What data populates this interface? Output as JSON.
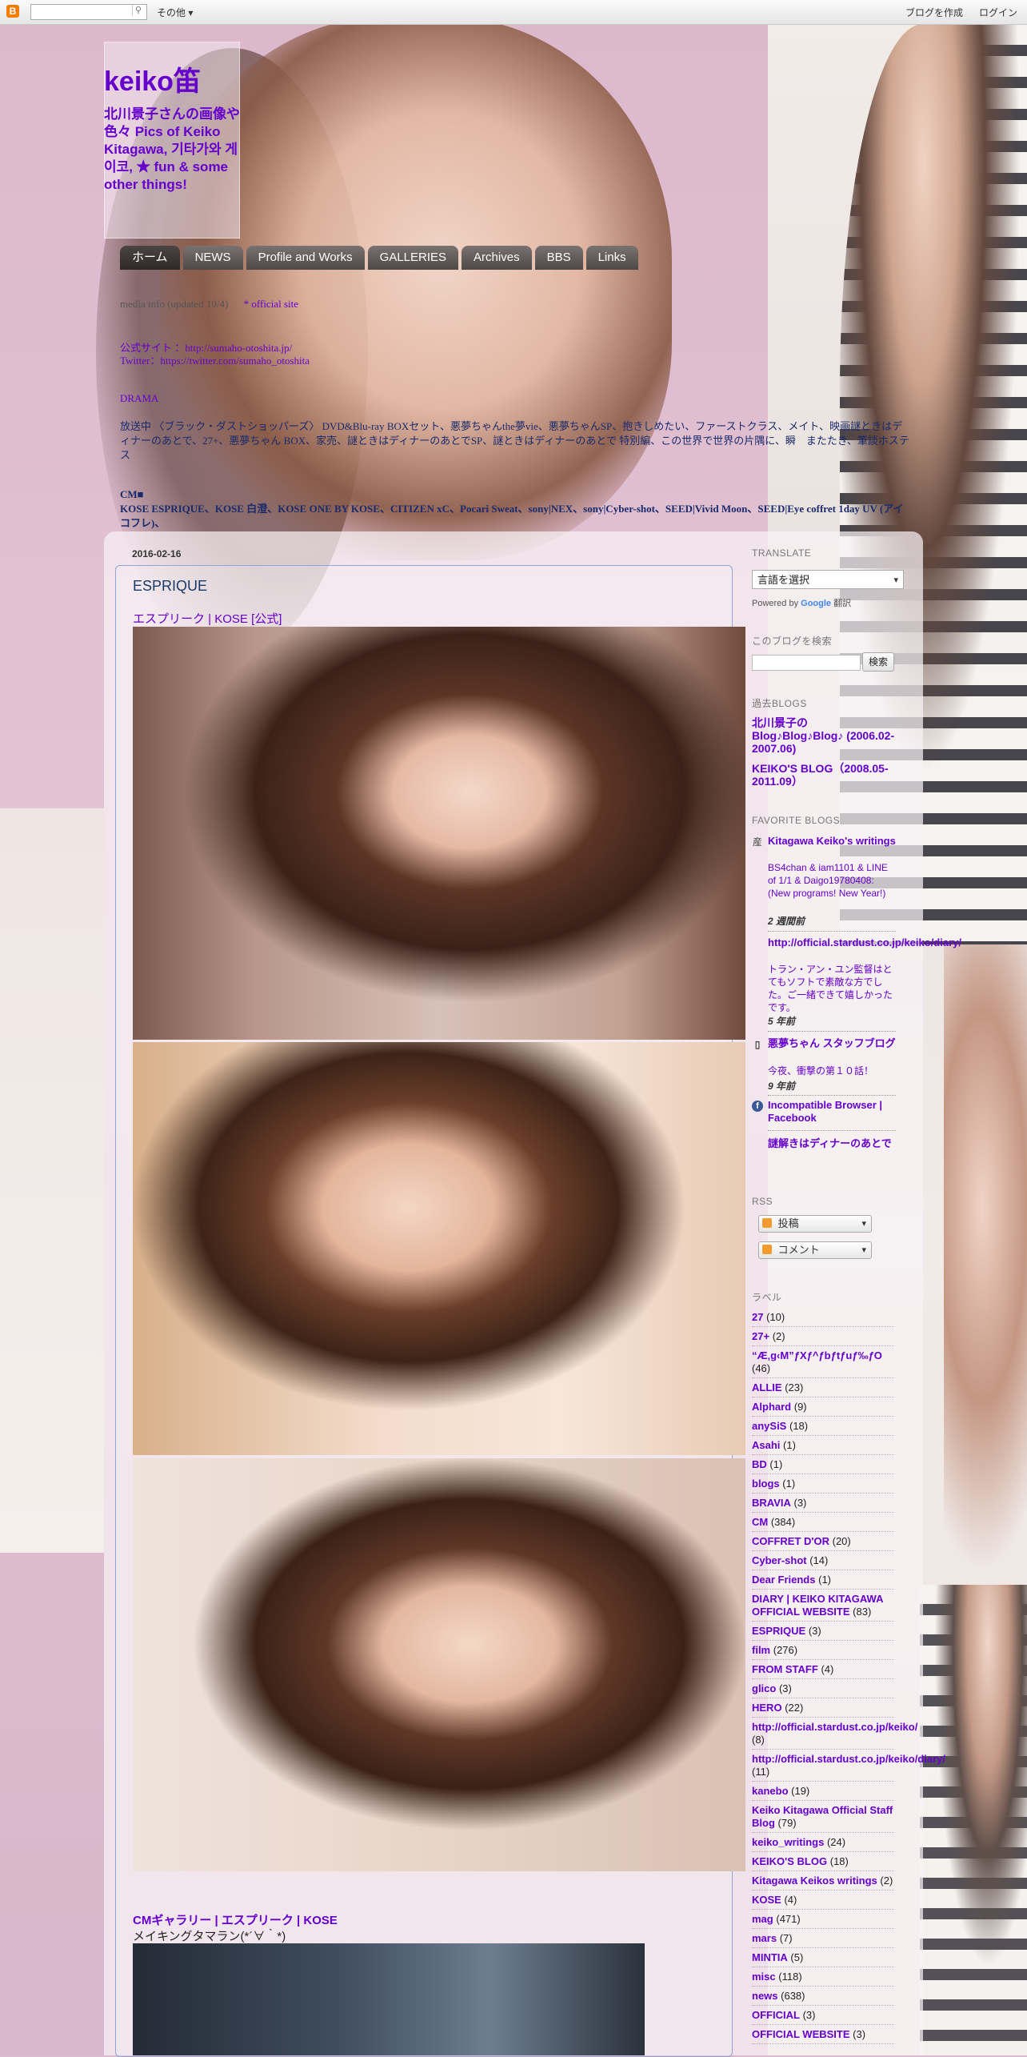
{
  "navbar": {
    "logo": "B",
    "search_icon": "search-icon",
    "more_label": "その他 ▾",
    "create_blog": "ブログを作成",
    "login": "ログイン"
  },
  "header": {
    "title": "keiko笛",
    "description": "北川景子さんの画像や色々 Pics of Keiko Kitagawa, 기타가와 게이코, ★ fun & some other things!"
  },
  "tabs": [
    "ホーム",
    "NEWS",
    "Profile and Works",
    "GALLERIES",
    "Archives",
    "BBS",
    "Links"
  ],
  "info": {
    "media_line": "media info (updated 10/4)",
    "official_link": "* official site",
    "smart_line1": "公式サイト ：http://sumaho-otoshita.jp/",
    "smart_line2": "Twitter：https://twitter.com/sumaho_otoshita",
    "drama_head": "DRAMA",
    "drama_body": "放送中 〈ブラック・ダストショッパーズ〉 DVD&Blu-ray BOXセット、悪夢ちゃんthe夢vie、悪夢ちゃんSP、抱きしめたい、ファーストクラス、メイト、映画謎ときはディナーのあとで、27+、悪夢ちゃん BOX、家売、謎ときはディナーのあとでSP、謎ときはディナーのあとで 特別編、この世界で世界の片隅に、瞬　またたき、筆談ホステス",
    "cm_head": "CM■",
    "cm_body": "KOSE ESPRIQUE、KOSE 白澄、KOSE ONE BY KOSE、CITIZEN xC、Pocari Sweat、sony|NEX、sony|Cyber-shot、SEED|Vivid Moon、SEED|Eye coffret 1day UV (アイコフレ)、"
  },
  "post": {
    "date": "2016-02-16",
    "title": "ESPRIQUE",
    "source_link": "エスプリーク | KOSE [公式]",
    "gallery_link": "CMギャラリー | エスプリーク | KOSE",
    "making_text": "メイキングタマラン(*´∀｀*)"
  },
  "sidebar": {
    "translate_head": "TRANSLATE",
    "translate_select": "言語を選択",
    "powered_by": "Powered by",
    "google": "Google",
    "translate_word": "翻訳",
    "search_head": "このブログを検索",
    "search_button": "検索",
    "past_head": "過去BLOGS",
    "past_links": [
      "北川景子の Blog♪Blog♪Blog♪ (2006.02-2007.06)",
      "KEIKO'S BLOG（2008.05-2011.09）"
    ],
    "fav_head": "FAVORITE BLOGS",
    "favorites": [
      {
        "title": "Kitagawa Keiko's writings",
        "sub": "BS4chan & iam1101 & LINE of 1/1 & Daigo19780408: (New programs! New Year!)",
        "time": "2 週間前",
        "icon": "blog-icon"
      },
      {
        "title": "http://official.stardust.co.jp/keiko/diary/",
        "sub": "トラン・アン・ユン監督はとてもソフトで素敵な方でした。ご一緒できて嬉しかったです。",
        "time": "5 年前",
        "icon": "none"
      },
      {
        "title": "悪夢ちゃん スタッフブログ",
        "sub": "今夜、衝撃の第１０話！",
        "time": "9 年前",
        "icon": "blog-icon"
      },
      {
        "title": "Incompatible Browser | Facebook",
        "sub": "",
        "time": "",
        "icon": "facebook-icon"
      },
      {
        "title": "謎解きはディナーのあとで",
        "sub": "",
        "time": "",
        "icon": "none"
      }
    ],
    "rss_head": "RSS",
    "rss_posts": "投稿",
    "rss_comments": "コメント",
    "labels_head": "ラベル",
    "labels": [
      {
        "name": "27",
        "count": "(10)"
      },
      {
        "name": "27+",
        "count": "(2)"
      },
      {
        "name": "“Æ‚g‹M”ƒXƒ^ƒbƒtƒuƒ‰ƒO",
        "count": "(46)"
      },
      {
        "name": "ALLIE",
        "count": "(23)"
      },
      {
        "name": "Alphard",
        "count": "(9)"
      },
      {
        "name": "anySiS",
        "count": "(18)"
      },
      {
        "name": "Asahi",
        "count": "(1)"
      },
      {
        "name": "BD",
        "count": "(1)"
      },
      {
        "name": "blogs",
        "count": "(1)"
      },
      {
        "name": "BRAVIA",
        "count": "(3)"
      },
      {
        "name": "CM",
        "count": "(384)"
      },
      {
        "name": "COFFRET D'OR",
        "count": "(20)"
      },
      {
        "name": "Cyber-shot",
        "count": "(14)"
      },
      {
        "name": "Dear Friends",
        "count": "(1)"
      },
      {
        "name": "DIARY | KEIKO KITAGAWA OFFICIAL WEBSITE",
        "count": "(83)"
      },
      {
        "name": "ESPRIQUE",
        "count": "(3)"
      },
      {
        "name": "film",
        "count": "(276)"
      },
      {
        "name": "FROM STAFF",
        "count": "(4)"
      },
      {
        "name": "glico",
        "count": "(3)"
      },
      {
        "name": "HERO",
        "count": "(22)"
      },
      {
        "name": "http://official.stardust.co.jp/keiko/",
        "count": "(8)"
      },
      {
        "name": "http://official.stardust.co.jp/keiko/diary/",
        "count": "(11)"
      },
      {
        "name": "kanebo",
        "count": "(19)"
      },
      {
        "name": "Keiko Kitagawa Official Staff Blog",
        "count": "(79)"
      },
      {
        "name": "keiko_writings",
        "count": "(24)"
      },
      {
        "name": "KEIKO'S BLOG",
        "count": "(18)"
      },
      {
        "name": "Kitagawa Keikos writings",
        "count": "(2)"
      },
      {
        "name": "KOSE",
        "count": "(4)"
      },
      {
        "name": "mag",
        "count": "(471)"
      },
      {
        "name": "mars",
        "count": "(7)"
      },
      {
        "name": "MINTIA",
        "count": "(5)"
      },
      {
        "name": "misc",
        "count": "(118)"
      },
      {
        "name": "news",
        "count": "(638)"
      },
      {
        "name": "OFFICIAL",
        "count": "(3)"
      },
      {
        "name": "OFFICIAL WEBSITE",
        "count": "(3)"
      }
    ]
  }
}
